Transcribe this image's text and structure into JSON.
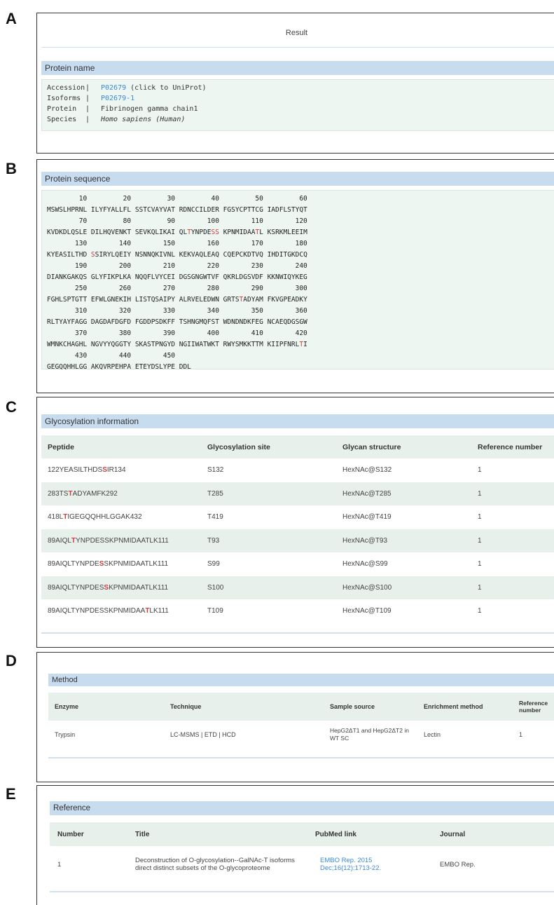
{
  "panels": {
    "a": "A",
    "b": "B",
    "c": "C",
    "d": "D",
    "e": "E"
  },
  "result_title": "Result",
  "protein_name": {
    "heading": "Protein name",
    "rows": [
      {
        "key": "Accession",
        "sep": "|",
        "value": "P02679",
        "suffix": " (click to UniProt)"
      },
      {
        "key": "Isoforms",
        "sep": "|",
        "value": "P02679-1",
        "suffix": ""
      },
      {
        "key": "Protein",
        "sep": "|",
        "value": "Fibrinogen gamma chain1",
        "suffix": ""
      },
      {
        "key": "Species",
        "sep": "|",
        "value": "Homo sapiens (Human)",
        "suffix": ""
      }
    ]
  },
  "protein_sequence": {
    "heading": "Protein sequence",
    "lines": [
      "        10         20         30         40         50         60",
      "MSWSLHPRNL ILYFYALLFL SSTCVAYVAT RDNCCILDER FGSYCPTTCG IADFLSTYQT",
      "        70         80         90        100        110        120",
      "KVDKDLQSLE DILHQVENKT SEVKQLIKAI QL|T|YNPDE|SS| KPNMIDAA|T|L KSRKMLEEIM",
      "       130        140        150        160        170        180",
      "KYEASILTHD |S|SIRYLQEIY NSNNQKIVNL KEKVAQLEAQ CQEPCKDTVQ IHDITGKDCQ",
      "       190        200        210        220        230        240",
      "DIANKGAKQS GLYFIKPLKA NQQFLVYCEI DGSGNGWTVF QKRLDGSVDF KKNWIQYKEG",
      "       250        260        270        280        290        300",
      "FGHLSPTGTT EFWLGNEKIH LISTQSAIPY ALRVELEDWN GRTS|T|ADYAM FKVGPEADKY",
      "       310        320        330        340        350        360",
      "RLTYAYFAGG DAGDAFDGFD FGDDPSDKFF TSHNGMQFST WDNDNDKFEG NCAEQDGSGW",
      "       370        380        390        400        410        420",
      "WMNKCHAGHL NGVYYQGGTY SKASTPNGYD NGIIWATWKT RWYSMKKTTM KIIPFNRL|T|I",
      "       430        440        450",
      "GEGQQHHLGG AKQVRPEHPA ETEYDSLYPE DDL"
    ]
  },
  "glycosylation": {
    "heading": "Glycosylation information",
    "columns": [
      "Peptide",
      "Glycosylation site",
      "Glycan structure",
      "Reference number"
    ],
    "rows": [
      {
        "pep_pre": "122YEASILTHDS",
        "pep_mark": "S",
        "pep_post": "IR134",
        "site": "S132",
        "glycan": "HexNAc@S132",
        "ref": "1"
      },
      {
        "pep_pre": "283TS",
        "pep_mark": "T",
        "pep_post": "ADYAMFK292",
        "site": "T285",
        "glycan": "HexNAc@T285",
        "ref": "1"
      },
      {
        "pep_pre": "418L",
        "pep_mark": "T",
        "pep_post": "IGEGQQHHLGGAK432",
        "site": "T419",
        "glycan": "HexNAc@T419",
        "ref": "1"
      },
      {
        "pep_pre": "89AIQL",
        "pep_mark": "T",
        "pep_post": "YNPDESSKPNMIDAATLK111",
        "site": "T93",
        "glycan": "HexNAc@T93",
        "ref": "1"
      },
      {
        "pep_pre": "89AIQLTYNPDE",
        "pep_mark": "S",
        "pep_post": "SKPNMIDAATLK111",
        "site": "S99",
        "glycan": "HexNAc@S99",
        "ref": "1"
      },
      {
        "pep_pre": "89AIQLTYNPDES",
        "pep_mark": "S",
        "pep_post": "KPNMIDAATLK111",
        "site": "S100",
        "glycan": "HexNAc@S100",
        "ref": "1"
      },
      {
        "pep_pre": "89AIQLTYNPDESSKPNMIDAA",
        "pep_mark": "T",
        "pep_post": "LK111",
        "site": "T109",
        "glycan": "HexNAc@T109",
        "ref": "1"
      }
    ]
  },
  "method": {
    "heading": "Method",
    "columns": [
      "Enzyme",
      "Technique",
      "Sample source",
      "Enrichment method",
      "Reference number"
    ],
    "rows": [
      {
        "enzyme": "Trypsin",
        "technique": "LC-MSMS | ETD | HCD",
        "sample": "HepG2ΔT1 and HepG2ΔT2 in WT SC",
        "enrichment": "Lectin",
        "ref": "1"
      }
    ]
  },
  "reference": {
    "heading": "Reference",
    "columns": [
      "Number",
      "Title",
      "PubMed link",
      "Journal"
    ],
    "rows": [
      {
        "number": "1",
        "title": "Deconstruction of O-glycosylation--GalNAc-T isoforms direct distinct subsets of the O-glycoproteome",
        "pubmed": "EMBO Rep. 2015 Dec;16(12):1713-22.",
        "journal": "EMBO Rep."
      }
    ]
  },
  "colors": {
    "header_bar": "#c8dcf0",
    "info_bg": "#eef6f2",
    "highlight": "#d23b3b",
    "link": "#3b8ad8"
  }
}
